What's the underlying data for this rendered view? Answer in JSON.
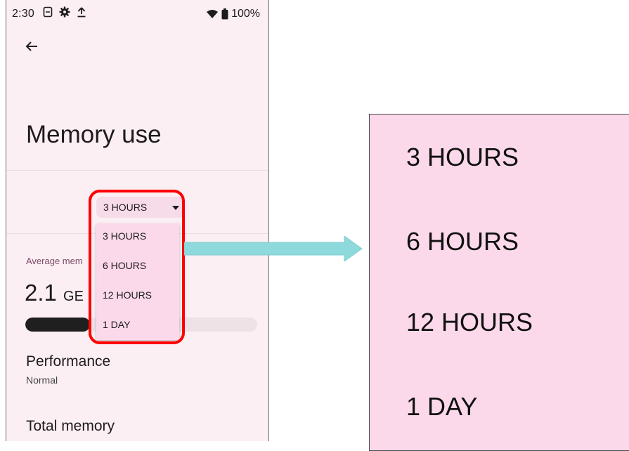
{
  "status_bar": {
    "time": "2:30",
    "battery": "100%",
    "icons_left": [
      "sim-icon",
      "settings-icon",
      "upload-icon"
    ],
    "icons_right": [
      "wifi-icon",
      "battery-icon"
    ]
  },
  "header": {
    "back_icon": "arrow-back-icon"
  },
  "page": {
    "title": "Memory use",
    "dropdown": {
      "selected": "3 HOURS",
      "options": [
        "3 HOURS",
        "6 HOURS",
        "12 HOURS",
        "1 DAY"
      ]
    },
    "average_label": "Average mem",
    "average_value_number": "2.1",
    "average_value_unit": "GE",
    "usage_fraction": 0.28,
    "performance": {
      "title": "Performance",
      "value": "Normal"
    },
    "total_memory": {
      "title": "Total memory"
    }
  },
  "zoom": {
    "items": [
      "3 HOURS",
      "6 HOURS",
      "12 HOURS",
      "1 DAY"
    ]
  },
  "colors": {
    "background": "#fbeff3",
    "menu": "#fbd9ea",
    "highlight": "#ff0000",
    "arrow": "#8ed9dc",
    "accent_label": "#7d4a68"
  }
}
